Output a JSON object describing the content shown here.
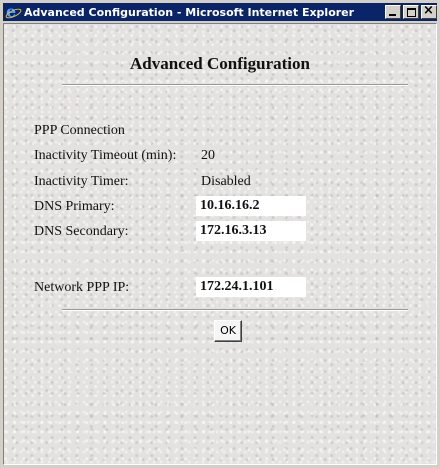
{
  "window": {
    "title": "Advanced Configuration - Microsoft Internet Explorer",
    "icon": "internet-explorer-icon"
  },
  "page": {
    "heading": "Advanced Configuration",
    "rows": [
      {
        "label": "PPP Connection",
        "value": ""
      },
      {
        "label": "Inactivity Timeout (min):",
        "value": "20"
      },
      {
        "label": "Inactivity Timer:",
        "value": "Disabled"
      },
      {
        "label": "DNS Primary:",
        "value": "10.16.16.2"
      },
      {
        "label": "DNS Secondary:",
        "value": "172.16.3.13"
      },
      {
        "label": "Network PPP IP:",
        "value": "172.24.1.101"
      }
    ],
    "ok_label": "OK"
  },
  "colors": {
    "titlebar": "#0a246a",
    "background": "#e4e2e0"
  }
}
